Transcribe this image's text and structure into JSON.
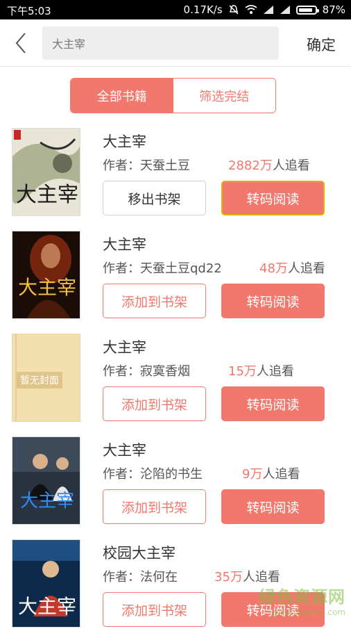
{
  "status_bar": {
    "time": "下午5:03",
    "net_speed": "0.17K/s",
    "battery": "87%",
    "battery_level": 0.87
  },
  "header": {
    "search_value": "大主宰",
    "confirm_label": "确定"
  },
  "tabs": [
    {
      "label": "全部书籍",
      "active": true
    },
    {
      "label": "筛选完结",
      "active": false
    }
  ],
  "books": [
    {
      "title": "大主宰",
      "author_prefix": "作者：",
      "author": "天蚕土豆",
      "followers_num": "2882万",
      "followers_suffix": "人追看",
      "action_label": "移出书架",
      "read_label": "转码阅读",
      "cover_text": "大主宰"
    },
    {
      "title": "大主宰",
      "author_prefix": "作者：",
      "author": "天蚕土豆qd22",
      "followers_num": "48万",
      "followers_suffix": "人追看",
      "action_label": "添加到书架",
      "read_label": "转码阅读",
      "cover_text": "大主宰"
    },
    {
      "title": "大主宰",
      "author_prefix": "作者：",
      "author": "寂寞香烟",
      "followers_num": "15万",
      "followers_suffix": "人追看",
      "action_label": "添加到书架",
      "read_label": "转码阅读",
      "cover_text": "暂无封面"
    },
    {
      "title": "大主宰",
      "author_prefix": "作者：",
      "author": "沦陷的书生",
      "followers_num": "9万",
      "followers_suffix": "人追看",
      "action_label": "添加到书架",
      "read_label": "转码阅读",
      "cover_text": "大主宰"
    },
    {
      "title": "校园大主宰",
      "author_prefix": "作者：",
      "author": "法何在",
      "followers_num": "35万",
      "followers_suffix": "人追看",
      "action_label": "添加到书架",
      "read_label": "转码阅读",
      "cover_text": "大主宰"
    }
  ],
  "watermark": {
    "line1": "绿色资源网",
    "line2": "www.downcc.com"
  },
  "colors": {
    "accent": "#f0786c",
    "text": "#333333",
    "status_bar": "#000000"
  }
}
